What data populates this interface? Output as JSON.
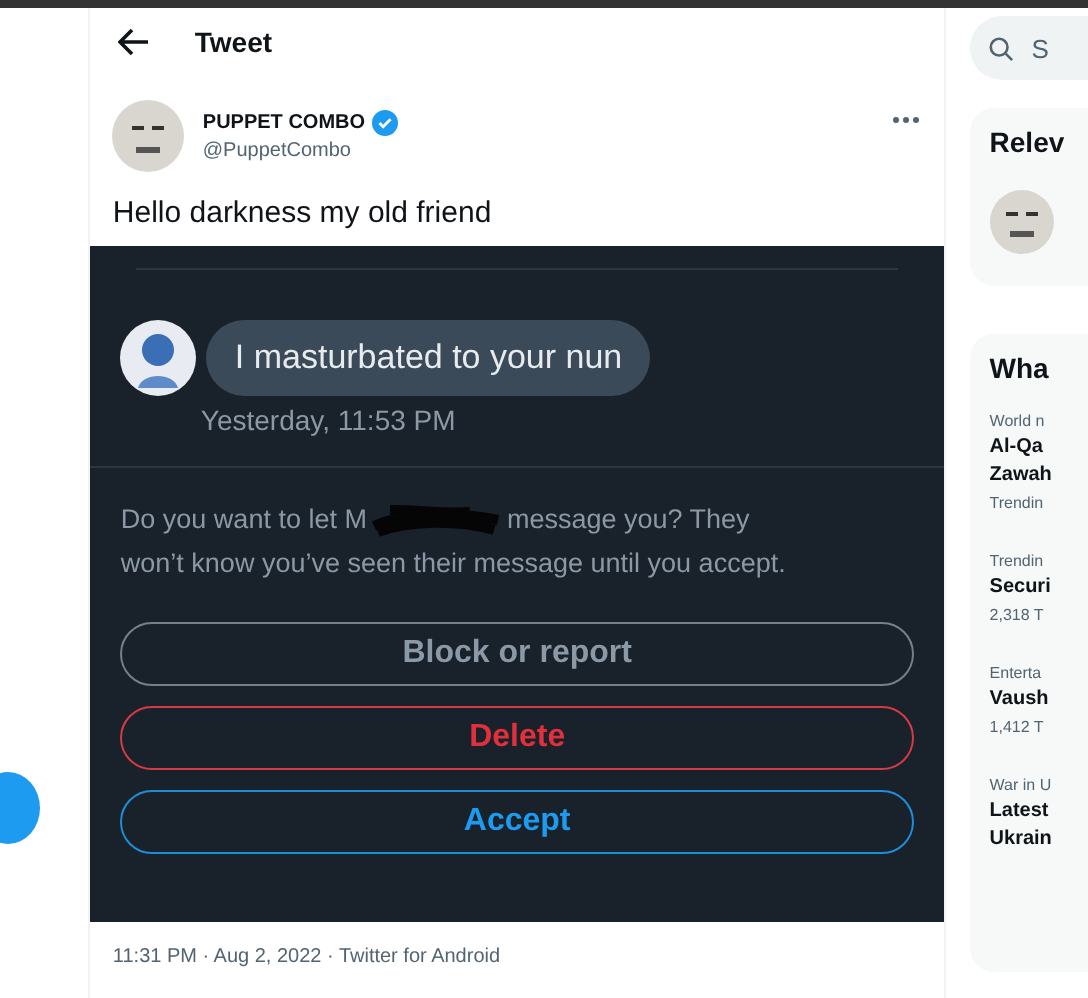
{
  "header": {
    "title": "Tweet"
  },
  "tweet": {
    "name": "PUPPET COMBO",
    "verified": true,
    "handle": "@PuppetCombo",
    "text": "Hello darkness my old friend",
    "screenshot": {
      "message": "I masturbated to your nun",
      "message_time": "Yesterday, 11:53 PM",
      "prompt_before": "Do you want to let M",
      "prompt_after": "message you? They",
      "prompt_line2": "won’t know you’ve seen their message until you accept.",
      "buttons": [
        {
          "label": "Block or report",
          "kind": "neutral"
        },
        {
          "label": "Delete",
          "kind": "danger"
        },
        {
          "label": "Accept",
          "kind": "primary"
        }
      ]
    },
    "meta": "11:31 PM · Aug 2, 2022 · Twitter for Android"
  },
  "sidebar": {
    "search_placeholder": "S",
    "relevant_title": "Relev",
    "trends_title": "Wha",
    "trends": [
      {
        "context": "World n",
        "lines": [
          "Al-Qa",
          "Zawah"
        ],
        "count": "Trendin"
      },
      {
        "context": "Trendin",
        "lines": [
          "Securi"
        ],
        "count": "2,318 T"
      },
      {
        "context": "Enterta",
        "lines": [
          "Vaush"
        ],
        "count": "1,412 T"
      },
      {
        "context": "War in U",
        "lines": [
          "Latest",
          "Ukrain"
        ]
      }
    ]
  }
}
